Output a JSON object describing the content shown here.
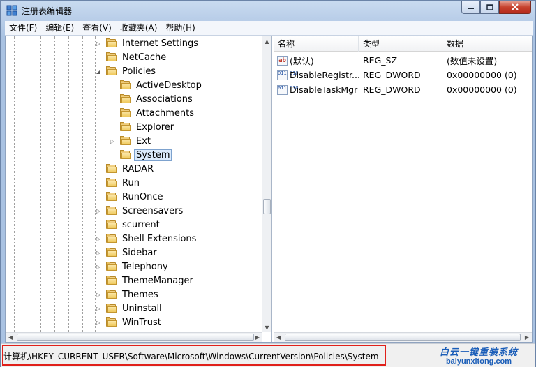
{
  "window": {
    "title": "注册表编辑器"
  },
  "menu": [
    "文件(F)",
    "编辑(E)",
    "查看(V)",
    "收藏夹(A)",
    "帮助(H)"
  ],
  "tree": [
    {
      "label": "Internet Settings",
      "expander": "collapsed",
      "level": 1
    },
    {
      "label": "NetCache",
      "expander": "none",
      "level": 1
    },
    {
      "label": "Policies",
      "expander": "expanded",
      "level": 1
    },
    {
      "label": "ActiveDesktop",
      "expander": "none",
      "level": 2
    },
    {
      "label": "Associations",
      "expander": "none",
      "level": 2
    },
    {
      "label": "Attachments",
      "expander": "none",
      "level": 2
    },
    {
      "label": "Explorer",
      "expander": "none",
      "level": 2
    },
    {
      "label": "Ext",
      "expander": "collapsed",
      "level": 2
    },
    {
      "label": "System",
      "expander": "none",
      "level": 2,
      "selected": true
    },
    {
      "label": "RADAR",
      "expander": "none",
      "level": 1
    },
    {
      "label": "Run",
      "expander": "none",
      "level": 1
    },
    {
      "label": "RunOnce",
      "expander": "none",
      "level": 1
    },
    {
      "label": "Screensavers",
      "expander": "collapsed",
      "level": 1
    },
    {
      "label": "scurrent",
      "expander": "none",
      "level": 1
    },
    {
      "label": "Shell Extensions",
      "expander": "collapsed",
      "level": 1
    },
    {
      "label": "Sidebar",
      "expander": "collapsed",
      "level": 1
    },
    {
      "label": "Telephony",
      "expander": "collapsed",
      "level": 1
    },
    {
      "label": "ThemeManager",
      "expander": "none",
      "level": 1
    },
    {
      "label": "Themes",
      "expander": "collapsed",
      "level": 1
    },
    {
      "label": "Uninstall",
      "expander": "collapsed",
      "level": 1
    },
    {
      "label": "WinTrust",
      "expander": "collapsed",
      "level": 1
    }
  ],
  "list": {
    "columns": [
      "名称",
      "类型",
      "数据"
    ],
    "rows": [
      {
        "icon": "string-value-icon",
        "icon_text": "ab",
        "name": "(默认)",
        "type": "REG_SZ",
        "data": "(数值未设置)"
      },
      {
        "icon": "binary-value-icon",
        "icon_text": "011 110",
        "name": "DisableRegistr...",
        "type": "REG_DWORD",
        "data": "0x00000000 (0)"
      },
      {
        "icon": "binary-value-icon",
        "icon_text": "011 110",
        "name": "DisableTaskMgr",
        "type": "REG_DWORD",
        "data": "0x00000000 (0)"
      }
    ]
  },
  "status": {
    "path": "计算机\\HKEY_CURRENT_USER\\Software\\Microsoft\\Windows\\CurrentVersion\\Policies\\System"
  },
  "watermark": {
    "cn": "白云一键重装系统",
    "en": "baiyunxitong.com"
  },
  "colors": {
    "highlight": "#e0201a",
    "selection": "#dcebfc",
    "watermark": "#1a5db8"
  }
}
